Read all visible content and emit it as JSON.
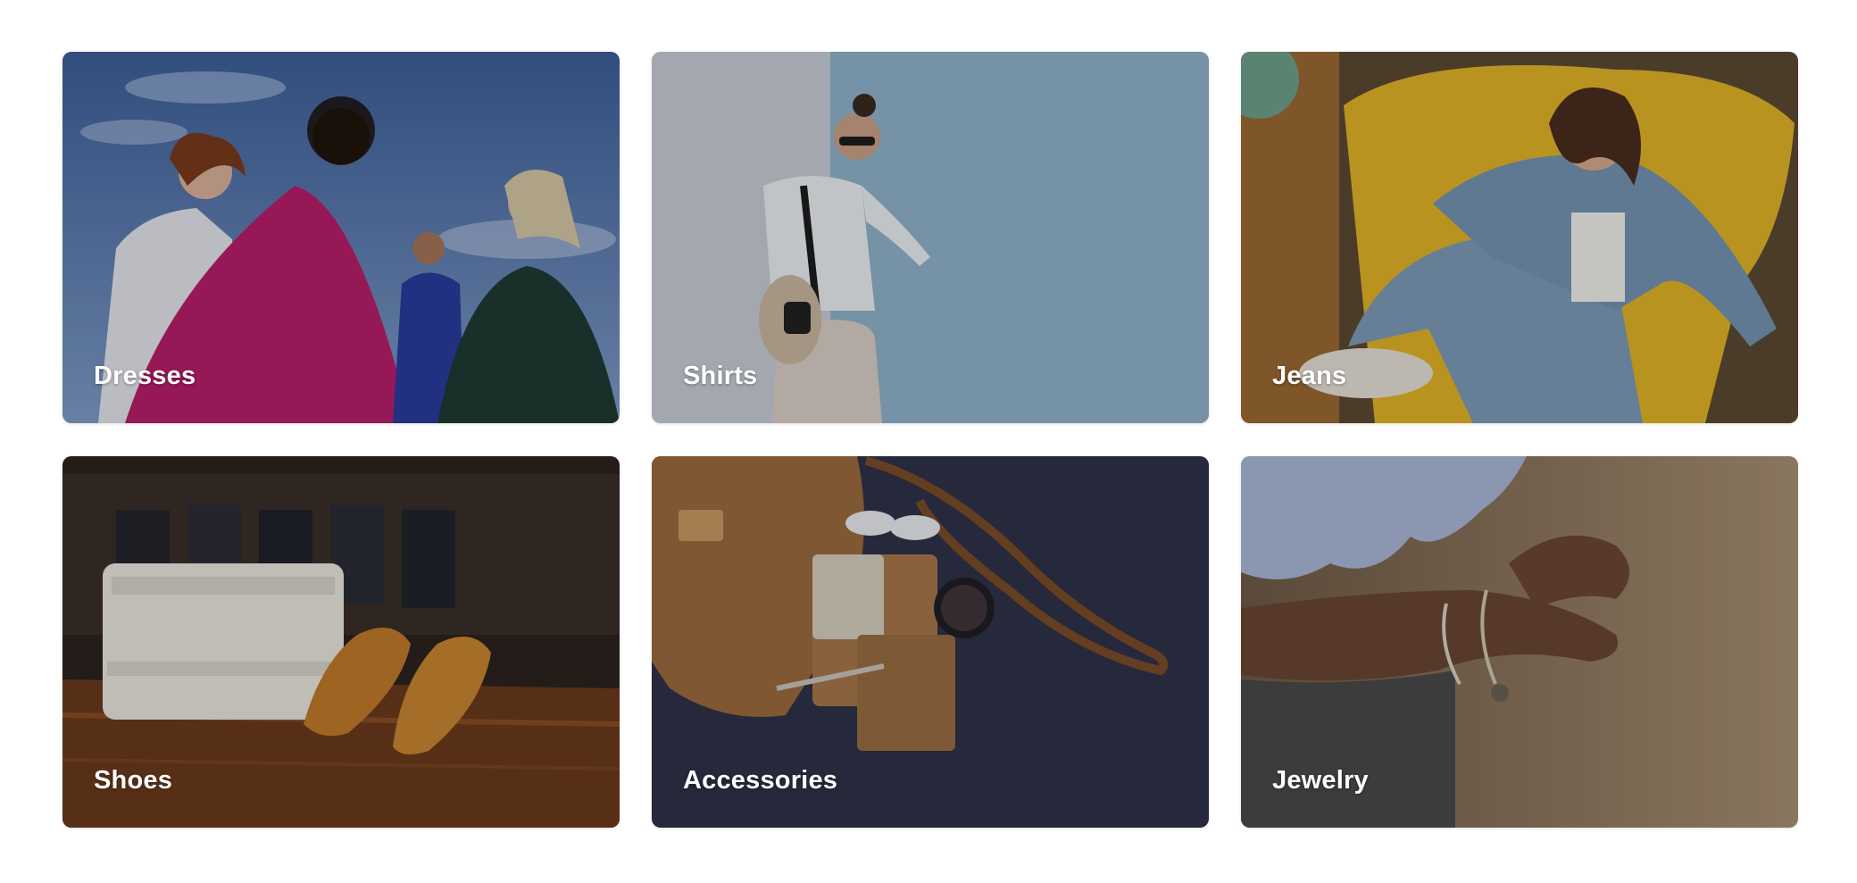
{
  "categories": [
    {
      "label": "Dresses",
      "image": "dresses-image"
    },
    {
      "label": "Shirts",
      "image": "shirts-image"
    },
    {
      "label": "Jeans",
      "image": "jeans-image"
    },
    {
      "label": "Shoes",
      "image": "shoes-image"
    },
    {
      "label": "Accessories",
      "image": "accessories-image"
    },
    {
      "label": "Jewelry",
      "image": "jewelry-image"
    }
  ]
}
